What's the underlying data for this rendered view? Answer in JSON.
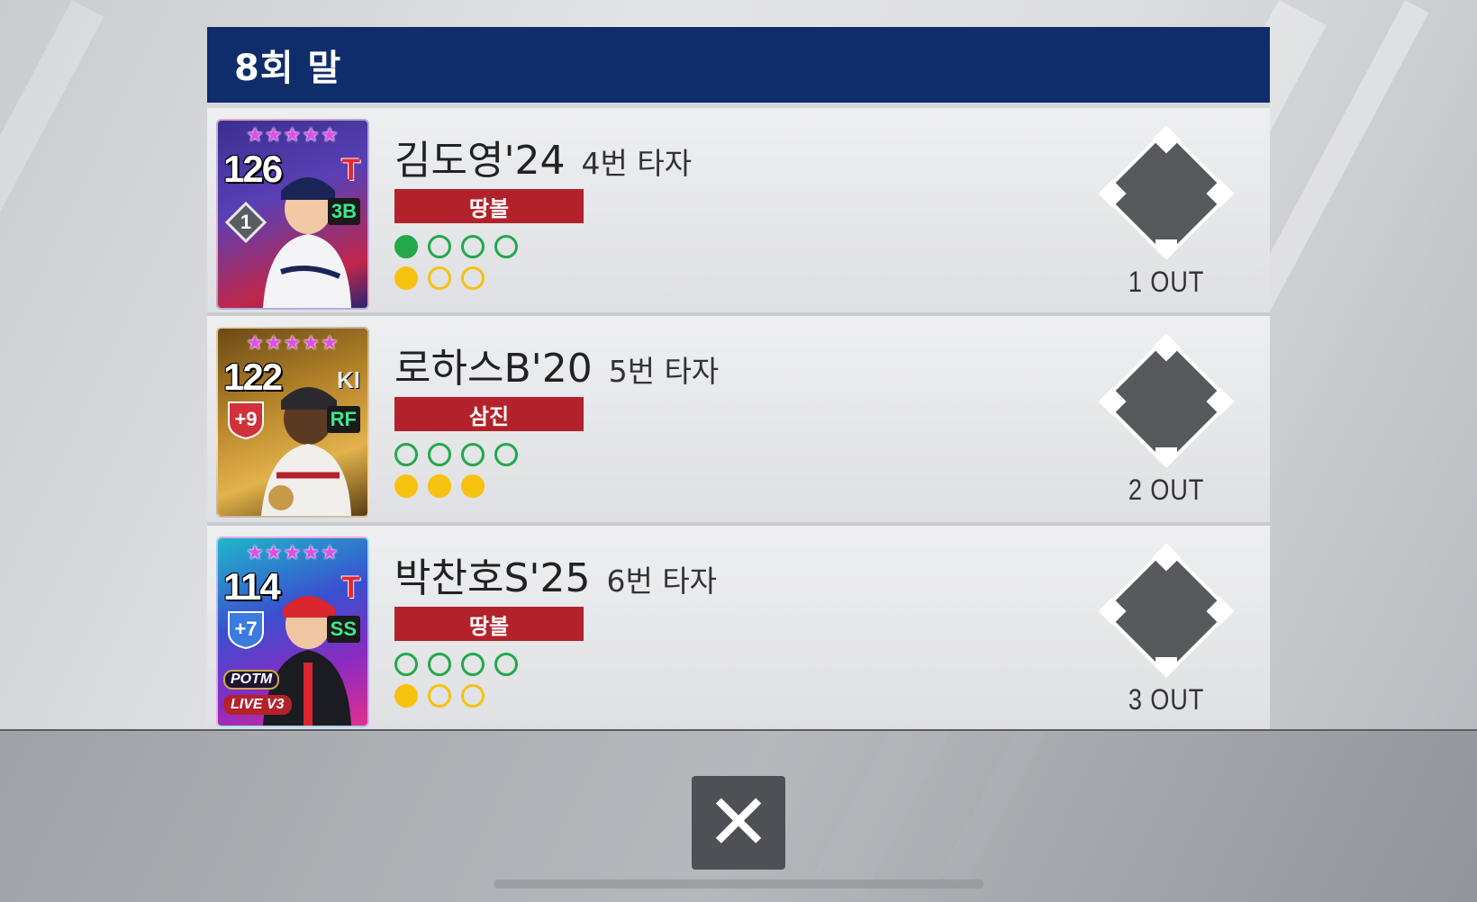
{
  "header": {
    "inning": "8회 말"
  },
  "batters": [
    {
      "card": {
        "stars": "★★★★★",
        "ovr": "126",
        "team_logo": "T",
        "position": "3B",
        "badge": "1",
        "theme": "korea"
      },
      "name": "김도영'24",
      "order": "4번 타자",
      "result": "땅볼",
      "balls": [
        true,
        false,
        false,
        false
      ],
      "strikes": [
        true,
        false,
        false
      ],
      "outs": "1 OUT"
    },
    {
      "card": {
        "stars": "★★★★★",
        "ovr": "122",
        "team_logo": "KI",
        "position": "RF",
        "badge": "+9",
        "theme": "gold"
      },
      "name": "로하스B'20",
      "order": "5번 타자",
      "result": "삼진",
      "balls": [
        false,
        false,
        false,
        false
      ],
      "strikes": [
        true,
        true,
        true
      ],
      "outs": "2 OUT"
    },
    {
      "card": {
        "stars": "★★★★★",
        "ovr": "114",
        "team_logo": "T",
        "position": "SS",
        "badge": "+7",
        "theme": "neon",
        "tag1": "POTM",
        "tag2": "LIVE V3"
      },
      "name": "박찬호S'25",
      "order": "6번 타자",
      "result": "땅볼",
      "balls": [
        false,
        false,
        false,
        false
      ],
      "strikes": [
        true,
        false,
        false
      ],
      "outs": "3 OUT"
    }
  ],
  "controls": {
    "close_label": "✕"
  },
  "colors": {
    "header_bg": "#0f2c6b",
    "result_bg": "#b3222a",
    "ball_green": "#22a94a",
    "strike_yellow": "#f5c20f"
  }
}
